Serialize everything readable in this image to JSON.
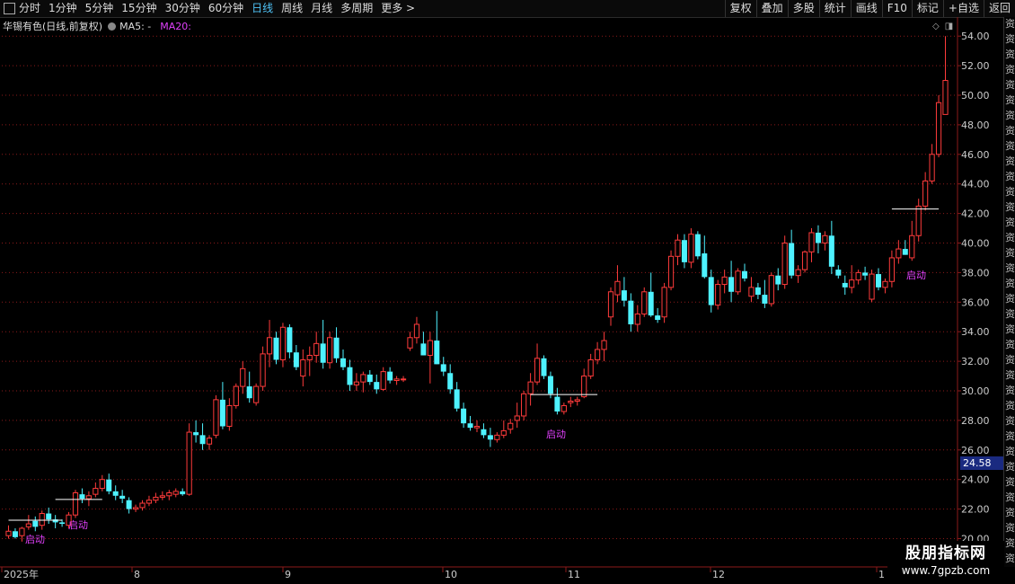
{
  "toolbar": {
    "periods": [
      "分时",
      "1分钟",
      "5分钟",
      "15分钟",
      "30分钟",
      "60分钟",
      "日线",
      "周线",
      "月线",
      "多周期",
      "更多 >"
    ],
    "active_period": "日线",
    "buttons": [
      "复权",
      "叠加",
      "多股",
      "统计",
      "画线",
      "F10",
      "标记",
      "+自选",
      "返回"
    ]
  },
  "legend": {
    "title": "华锡有色(日线,前复权)",
    "ma5": "MA5: -",
    "ma20": "MA20:"
  },
  "colors": {
    "up": "#ff3b3b",
    "down": "#4ef2ff",
    "grid": "#8b1a1a",
    "signal": "#e040fb",
    "axis_text": "#cccccc"
  },
  "chart_data": {
    "type": "candlestick",
    "ylim": [
      19,
      55
    ],
    "y_ticks": [
      20,
      22,
      24,
      26,
      28,
      30,
      32,
      34,
      36,
      38,
      40,
      42,
      44,
      46,
      48,
      50,
      52,
      54
    ],
    "x_labels": [
      "2025年",
      "8",
      "9",
      "10",
      "11",
      "12",
      "1"
    ],
    "current_price": "24.58",
    "signals": [
      "启动",
      "启动",
      "启动",
      "启动"
    ],
    "candles": [
      [
        20.2,
        20.9,
        20.0,
        20.5
      ],
      [
        20.5,
        20.7,
        20.0,
        20.1
      ],
      [
        20.2,
        20.8,
        19.8,
        20.7
      ],
      [
        20.8,
        21.6,
        20.6,
        21.0
      ],
      [
        21.2,
        21.5,
        20.5,
        20.8
      ],
      [
        20.9,
        21.9,
        20.6,
        21.7
      ],
      [
        21.7,
        22.1,
        21.0,
        21.3
      ],
      [
        21.3,
        21.6,
        20.7,
        21.1
      ],
      [
        21.1,
        21.3,
        20.8,
        21.0
      ],
      [
        20.9,
        21.8,
        20.7,
        21.6
      ],
      [
        21.6,
        23.3,
        21.4,
        23.1
      ],
      [
        23.0,
        23.4,
        22.4,
        22.7
      ],
      [
        22.7,
        23.2,
        22.2,
        22.9
      ],
      [
        23.0,
        23.8,
        22.8,
        23.4
      ],
      [
        23.4,
        24.3,
        23.2,
        24.0
      ],
      [
        24.0,
        24.4,
        23.0,
        23.2
      ],
      [
        23.2,
        23.6,
        22.6,
        22.9
      ],
      [
        22.9,
        23.3,
        22.4,
        22.7
      ],
      [
        22.6,
        22.8,
        21.7,
        22.0
      ],
      [
        22.0,
        22.3,
        21.8,
        22.1
      ],
      [
        22.1,
        22.6,
        21.9,
        22.4
      ],
      [
        22.4,
        22.9,
        22.2,
        22.6
      ],
      [
        22.6,
        23.1,
        22.4,
        22.8
      ],
      [
        22.8,
        23.2,
        22.6,
        22.9
      ],
      [
        22.9,
        23.3,
        22.6,
        23.1
      ],
      [
        23.0,
        23.4,
        22.8,
        23.2
      ],
      [
        23.2,
        23.4,
        22.9,
        23.0
      ],
      [
        23.0,
        27.8,
        22.9,
        27.2
      ],
      [
        27.2,
        28.0,
        26.5,
        27.0
      ],
      [
        27.0,
        27.8,
        26.0,
        26.4
      ],
      [
        26.4,
        27.0,
        26.0,
        26.8
      ],
      [
        27.0,
        29.7,
        26.8,
        29.4
      ],
      [
        29.4,
        30.6,
        27.4,
        27.6
      ],
      [
        27.6,
        29.5,
        27.3,
        29.0
      ],
      [
        29.0,
        30.5,
        28.8,
        30.3
      ],
      [
        30.3,
        32.0,
        29.8,
        31.5
      ],
      [
        30.3,
        31.3,
        29.2,
        29.5
      ],
      [
        29.2,
        30.5,
        29.0,
        30.3
      ],
      [
        30.3,
        33.0,
        30.0,
        32.5
      ],
      [
        32.5,
        34.8,
        31.6,
        33.6
      ],
      [
        33.6,
        34.0,
        31.8,
        32.1
      ],
      [
        32.1,
        34.6,
        31.6,
        34.3
      ],
      [
        34.3,
        34.5,
        32.2,
        32.6
      ],
      [
        32.6,
        33.1,
        31.4,
        31.6
      ],
      [
        31.0,
        32.8,
        30.3,
        32.1
      ],
      [
        32.1,
        33.0,
        31.0,
        32.4
      ],
      [
        32.4,
        34.0,
        31.9,
        33.2
      ],
      [
        33.2,
        34.8,
        31.5,
        31.9
      ],
      [
        31.9,
        34.0,
        31.5,
        33.6
      ],
      [
        33.6,
        34.3,
        31.9,
        32.2
      ],
      [
        32.2,
        32.8,
        31.4,
        31.6
      ],
      [
        31.6,
        32.1,
        30.0,
        30.4
      ],
      [
        30.4,
        31.2,
        30.0,
        30.6
      ],
      [
        30.6,
        31.3,
        29.9,
        31.1
      ],
      [
        31.1,
        31.4,
        30.4,
        30.6
      ],
      [
        30.6,
        31.1,
        29.8,
        30.1
      ],
      [
        30.1,
        31.6,
        30.0,
        31.3
      ],
      [
        31.3,
        31.6,
        30.5,
        30.7
      ],
      [
        30.7,
        31.0,
        30.4,
        30.8
      ],
      [
        30.8,
        31.0,
        30.6,
        30.8
      ],
      [
        32.9,
        34.0,
        32.7,
        33.6
      ],
      [
        33.6,
        35.0,
        33.2,
        34.5
      ],
      [
        33.2,
        34.0,
        32.4,
        32.4
      ],
      [
        32.4,
        34.0,
        30.5,
        33.4
      ],
      [
        33.4,
        35.4,
        31.8,
        31.8
      ],
      [
        31.8,
        32.3,
        31.0,
        31.3
      ],
      [
        31.2,
        31.8,
        29.8,
        30.1
      ],
      [
        30.1,
        30.6,
        28.6,
        28.8
      ],
      [
        28.8,
        29.2,
        27.5,
        27.8
      ],
      [
        27.8,
        28.3,
        27.3,
        27.5
      ],
      [
        27.5,
        28.0,
        27.2,
        27.6
      ],
      [
        27.4,
        27.8,
        26.8,
        27.0
      ],
      [
        27.0,
        27.5,
        26.2,
        26.7
      ],
      [
        26.7,
        27.2,
        26.5,
        27.0
      ],
      [
        27.0,
        28.0,
        26.8,
        27.3
      ],
      [
        27.4,
        28.1,
        27.1,
        27.8
      ],
      [
        28.0,
        29.2,
        27.5,
        28.3
      ],
      [
        28.3,
        30.0,
        28.0,
        29.8
      ],
      [
        29.8,
        31.2,
        29.0,
        30.6
      ],
      [
        30.6,
        33.2,
        30.4,
        32.2
      ],
      [
        32.2,
        32.4,
        30.8,
        31.0
      ],
      [
        31.0,
        31.3,
        29.5,
        29.8
      ],
      [
        29.6,
        30.2,
        28.4,
        28.6
      ],
      [
        28.6,
        29.2,
        28.4,
        29.0
      ],
      [
        29.2,
        29.6,
        28.9,
        29.3
      ],
      [
        29.3,
        29.6,
        29.0,
        29.4
      ],
      [
        29.6,
        31.5,
        29.5,
        31.0
      ],
      [
        31.0,
        32.5,
        30.8,
        32.1
      ],
      [
        32.1,
        33.3,
        31.8,
        32.8
      ],
      [
        32.8,
        34.0,
        32.0,
        33.4
      ],
      [
        35.0,
        37.0,
        34.4,
        36.7
      ],
      [
        36.5,
        38.5,
        36.0,
        37.4
      ],
      [
        36.8,
        37.7,
        35.7,
        36.1
      ],
      [
        36.1,
        36.6,
        34.0,
        34.5
      ],
      [
        34.5,
        35.8,
        34.0,
        35.2
      ],
      [
        35.2,
        37.0,
        35.0,
        36.7
      ],
      [
        36.7,
        38.0,
        35.0,
        35.1
      ],
      [
        35.1,
        35.6,
        34.6,
        34.8
      ],
      [
        35.0,
        37.3,
        34.6,
        37.0
      ],
      [
        37.0,
        39.5,
        36.8,
        39.1
      ],
      [
        39.1,
        40.6,
        38.5,
        40.2
      ],
      [
        40.2,
        40.6,
        38.3,
        38.7
      ],
      [
        38.7,
        41.0,
        38.3,
        40.6
      ],
      [
        40.6,
        40.8,
        38.9,
        39.1
      ],
      [
        39.3,
        40.5,
        37.6,
        37.7
      ],
      [
        37.7,
        38.2,
        35.3,
        35.8
      ],
      [
        35.8,
        37.5,
        35.5,
        37.2
      ],
      [
        37.2,
        38.2,
        36.6,
        37.7
      ],
      [
        37.7,
        38.8,
        36.0,
        36.7
      ],
      [
        36.7,
        38.3,
        36.5,
        38.1
      ],
      [
        38.1,
        38.6,
        37.4,
        37.6
      ],
      [
        36.4,
        37.7,
        36.0,
        37.0
      ],
      [
        37.0,
        37.3,
        36.2,
        36.5
      ],
      [
        36.5,
        37.5,
        35.6,
        35.9
      ],
      [
        35.9,
        38.0,
        35.7,
        37.8
      ],
      [
        37.8,
        38.3,
        36.8,
        37.2
      ],
      [
        37.2,
        40.5,
        36.9,
        40.0
      ],
      [
        40.0,
        40.9,
        37.6,
        37.8
      ],
      [
        37.8,
        38.5,
        37.3,
        38.2
      ],
      [
        38.2,
        39.5,
        38.0,
        39.4
      ],
      [
        39.4,
        41.0,
        38.7,
        40.7
      ],
      [
        40.7,
        41.2,
        39.3,
        40.0
      ],
      [
        40.0,
        40.8,
        39.5,
        40.5
      ],
      [
        40.5,
        41.5,
        37.9,
        38.4
      ],
      [
        38.2,
        38.5,
        37.6,
        37.8
      ],
      [
        37.3,
        37.8,
        36.5,
        37.0
      ],
      [
        37.0,
        38.5,
        36.6,
        37.5
      ],
      [
        37.5,
        38.2,
        37.2,
        38.0
      ],
      [
        38.0,
        38.4,
        37.5,
        37.8
      ],
      [
        36.2,
        38.2,
        36.0,
        37.9
      ],
      [
        37.9,
        38.3,
        36.8,
        37.0
      ],
      [
        37.0,
        37.6,
        36.6,
        37.4
      ],
      [
        37.4,
        39.5,
        37.0,
        39.0
      ],
      [
        39.0,
        40.2,
        38.6,
        39.6
      ],
      [
        39.6,
        40.2,
        39.2,
        39.2
      ],
      [
        39.0,
        41.5,
        38.8,
        40.5
      ],
      [
        40.5,
        43.0,
        40.1,
        42.5
      ],
      [
        42.5,
        44.8,
        42.2,
        44.2
      ],
      [
        44.2,
        46.7,
        44.0,
        46.0
      ],
      [
        46.0,
        50.0,
        45.8,
        49.5
      ],
      [
        48.7,
        54.0,
        48.7,
        51.0
      ]
    ]
  }
}
